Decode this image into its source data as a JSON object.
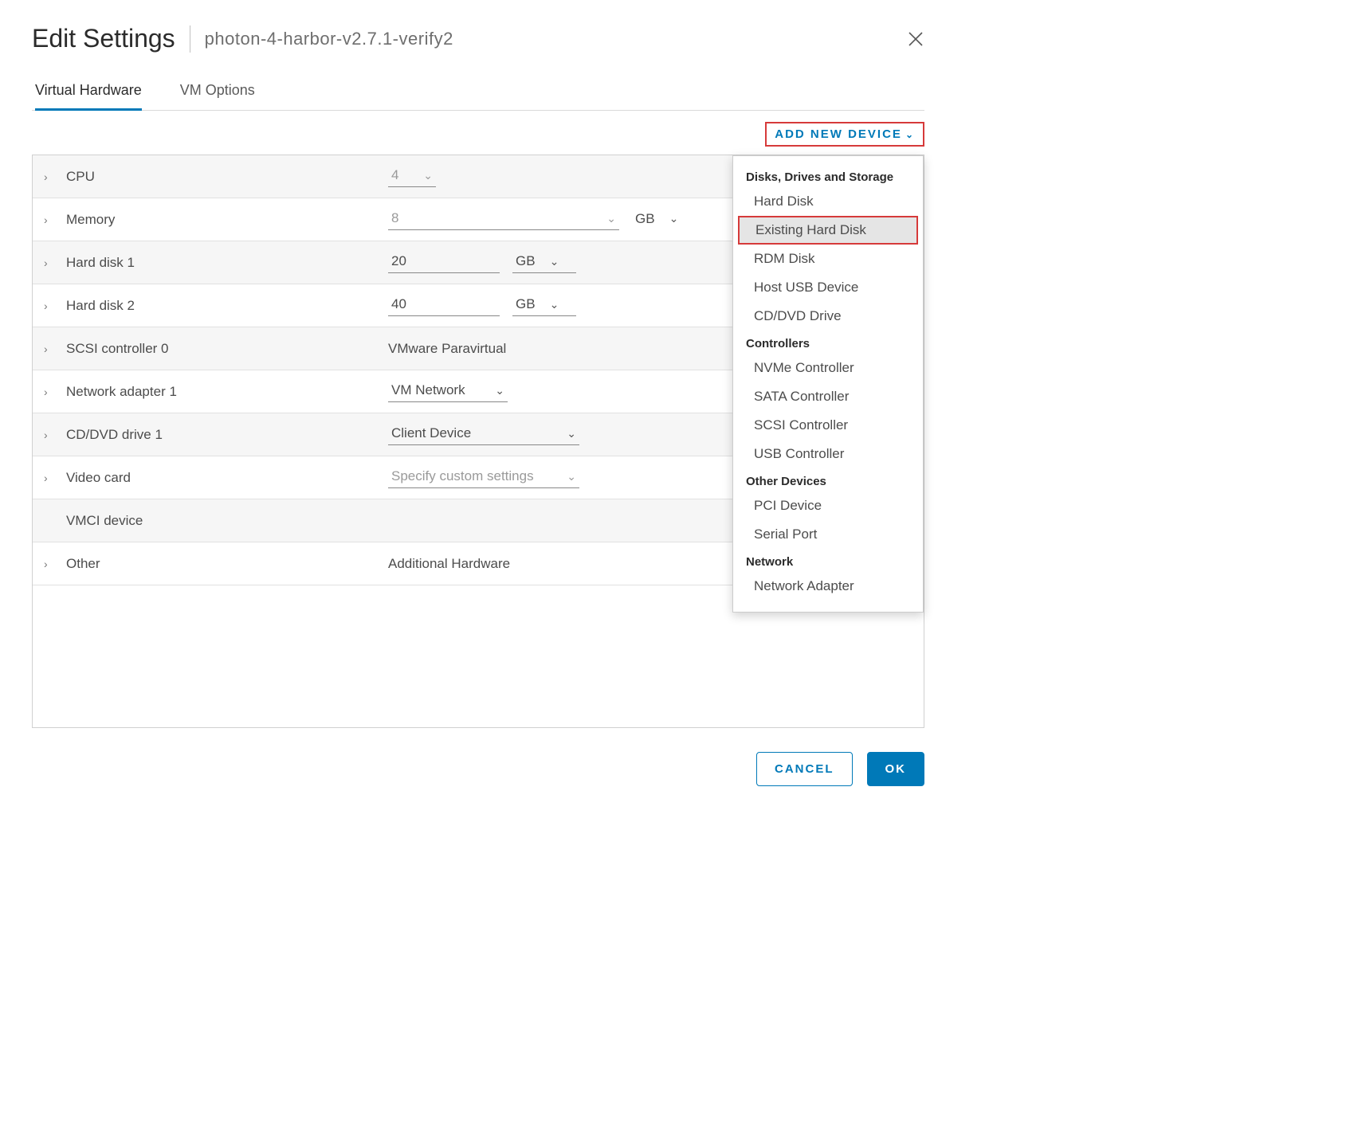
{
  "dialog": {
    "title": "Edit Settings",
    "vm_name": "photon-4-harbor-v2.7.1-verify2"
  },
  "tabs": {
    "virtual_hardware": "Virtual Hardware",
    "vm_options": "VM Options"
  },
  "toolbar": {
    "add_new_device": "ADD NEW DEVICE"
  },
  "rows": {
    "cpu": {
      "label": "CPU",
      "value": "4"
    },
    "memory": {
      "label": "Memory",
      "value": "8",
      "unit": "GB"
    },
    "hard_disk_1": {
      "label": "Hard disk 1",
      "value": "20",
      "unit": "GB"
    },
    "hard_disk_2": {
      "label": "Hard disk 2",
      "value": "40",
      "unit": "GB"
    },
    "scsi_controller_0": {
      "label": "SCSI controller 0",
      "value": "VMware Paravirtual"
    },
    "network_adapter_1": {
      "label": "Network adapter 1",
      "value": "VM Network"
    },
    "cd_dvd_drive_1": {
      "label": "CD/DVD drive 1",
      "value": "Client Device"
    },
    "video_card": {
      "label": "Video card",
      "value": "Specify custom settings"
    },
    "vmci_device": {
      "label": "VMCI device"
    },
    "other": {
      "label": "Other",
      "value": "Additional Hardware"
    }
  },
  "dropdown": {
    "sections": {
      "disks": {
        "title": "Disks, Drives and Storage",
        "hard_disk": "Hard Disk",
        "existing_hard_disk": "Existing Hard Disk",
        "rdm_disk": "RDM Disk",
        "host_usb_device": "Host USB Device",
        "cd_dvd_drive": "CD/DVD Drive"
      },
      "controllers": {
        "title": "Controllers",
        "nvme": "NVMe Controller",
        "sata": "SATA Controller",
        "scsi": "SCSI Controller",
        "usb": "USB Controller"
      },
      "other": {
        "title": "Other Devices",
        "pci": "PCI Device",
        "serial": "Serial Port"
      },
      "network": {
        "title": "Network",
        "adapter": "Network Adapter"
      }
    }
  },
  "footer": {
    "cancel": "CANCEL",
    "ok": "OK"
  }
}
